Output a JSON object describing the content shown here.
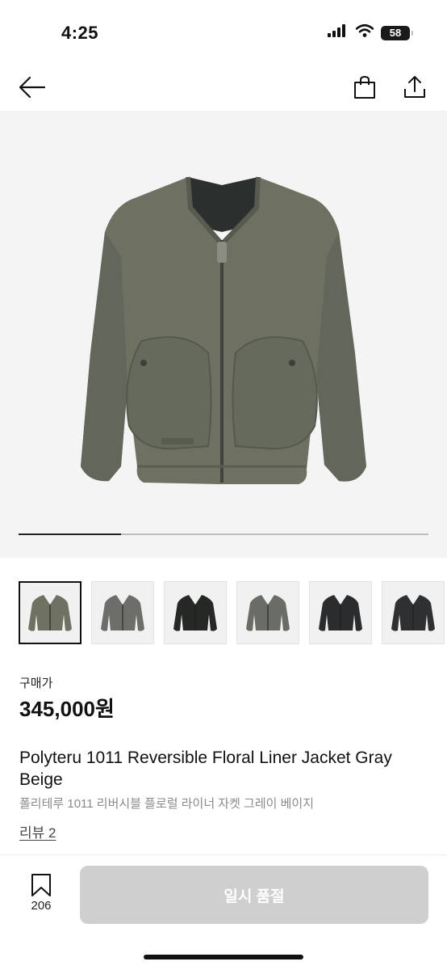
{
  "status_bar": {
    "time": "4:25",
    "battery": "58",
    "icons": [
      "signal-icon",
      "wifi-icon",
      "battery-icon"
    ]
  },
  "nav": {
    "icons": [
      "back-arrow-icon",
      "shopping-bag-icon",
      "share-icon"
    ]
  },
  "hero": {
    "gallery_progress": 0.25
  },
  "thumbnails": [
    {
      "variant": "olive",
      "color": "#6f7263",
      "selected": true
    },
    {
      "variant": "gray",
      "color": "#6d6d6a",
      "selected": false
    },
    {
      "variant": "black",
      "color": "#262826",
      "selected": false
    },
    {
      "variant": "gray",
      "color": "#6a6c66",
      "selected": false
    },
    {
      "variant": "black-floral",
      "color": "#2a2c2e",
      "selected": false
    },
    {
      "variant": "black-floral",
      "color": "#2e3032",
      "selected": false
    }
  ],
  "product": {
    "price_label": "구매가",
    "price": "345,000원",
    "title_en": "Polyteru 1011 Reversible Floral Liner Jacket Gray Beige",
    "title_ko": "폴리테루 1011 리버시블 플로럴 라이너 자켓 그레이 베이지",
    "review_link": "리뷰 2"
  },
  "bottom_bar": {
    "wish_count": "206",
    "wish_icon": "bookmark-icon",
    "soldout_label": "일시 품절"
  },
  "colors": {
    "jacket_olive": "#6e7162",
    "hero_background": "#f4f4f4",
    "disabled_button": "#cfcfcf"
  }
}
